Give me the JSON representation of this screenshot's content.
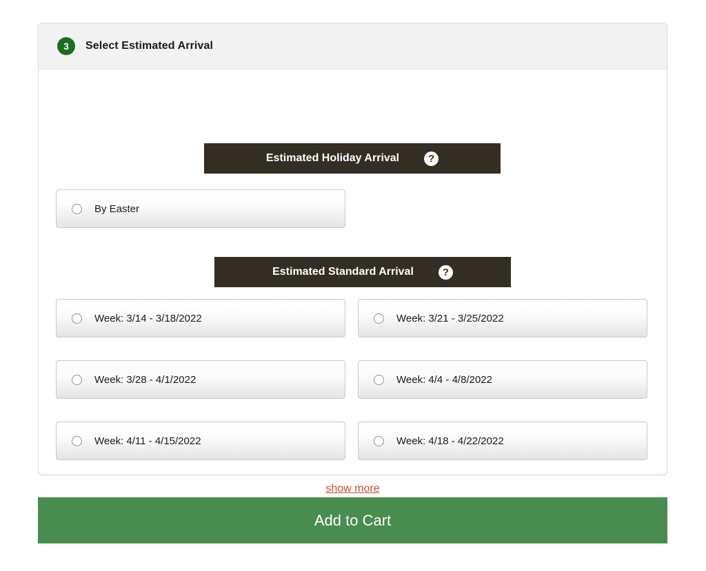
{
  "card": {
    "step_number": "3",
    "title": "Select Estimated Arrival"
  },
  "holiday_section": {
    "bar_label": "Estimated Holiday Arrival",
    "help_icon": "question-mark-icon",
    "help_glyph": "?",
    "options": [
      {
        "label": "By Easter",
        "selected": false
      }
    ]
  },
  "standard_section": {
    "bar_label": "Estimated Standard Arrival",
    "help_icon": "question-mark-icon",
    "help_glyph": "?",
    "options": [
      {
        "label": "Week: 3/14 - 3/18/2022",
        "selected": false
      },
      {
        "label": "Week: 3/21 - 3/25/2022",
        "selected": false
      },
      {
        "label": "Week: 3/28 - 4/1/2022",
        "selected": false
      },
      {
        "label": "Week: 4/4 - 4/8/2022",
        "selected": false
      },
      {
        "label": "Week: 4/11 - 4/15/2022",
        "selected": false
      },
      {
        "label": "Week: 4/18 - 4/22/2022",
        "selected": false
      }
    ]
  },
  "show_more": {
    "label": "show more"
  },
  "footer": {
    "add_to_cart_label": "Add to Cart"
  },
  "colors": {
    "step_badge_green": "#1e6b24",
    "section_bar_brown": "#352c23",
    "link_orange": "#c1502e",
    "cart_green": "#498c4f",
    "header_gray": "#f2f2f2"
  }
}
